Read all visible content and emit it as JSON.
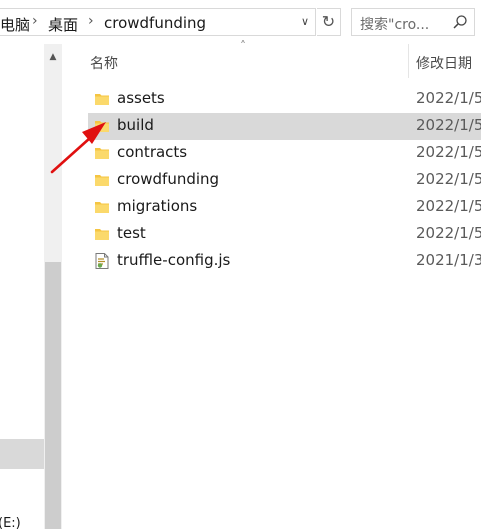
{
  "address_bar": {
    "crumbs": [
      "电脑",
      "桌面",
      "crowdfunding"
    ],
    "separator_icon": "chevron-right-icon",
    "dropdown_icon": "chevron-down-icon",
    "refresh_icon": "refresh-icon"
  },
  "search": {
    "placeholder": "搜索\"cro...",
    "icon": "search-icon"
  },
  "nav_pane": {
    "cut_off_text": "(E:)"
  },
  "file_list": {
    "columns": {
      "name": "名称",
      "date_modified": "修改日期"
    },
    "sort_icon": "sort-up-icon",
    "items": [
      {
        "name": "assets",
        "date": "2022/1/5",
        "type": "folder",
        "selected": false
      },
      {
        "name": "build",
        "date": "2022/1/5",
        "type": "folder",
        "selected": true
      },
      {
        "name": "contracts",
        "date": "2022/1/5",
        "type": "folder",
        "selected": false
      },
      {
        "name": "crowdfunding",
        "date": "2022/1/5",
        "type": "folder",
        "selected": false
      },
      {
        "name": "migrations",
        "date": "2022/1/5",
        "type": "folder",
        "selected": false
      },
      {
        "name": "test",
        "date": "2022/1/5",
        "type": "folder",
        "selected": false
      },
      {
        "name": "truffle-config.js",
        "date": "2021/1/3",
        "type": "js-file",
        "selected": false
      }
    ]
  },
  "colors": {
    "selection": "#d9d9d9",
    "folder": "#f5c542",
    "annotation_arrow": "#e01010"
  }
}
